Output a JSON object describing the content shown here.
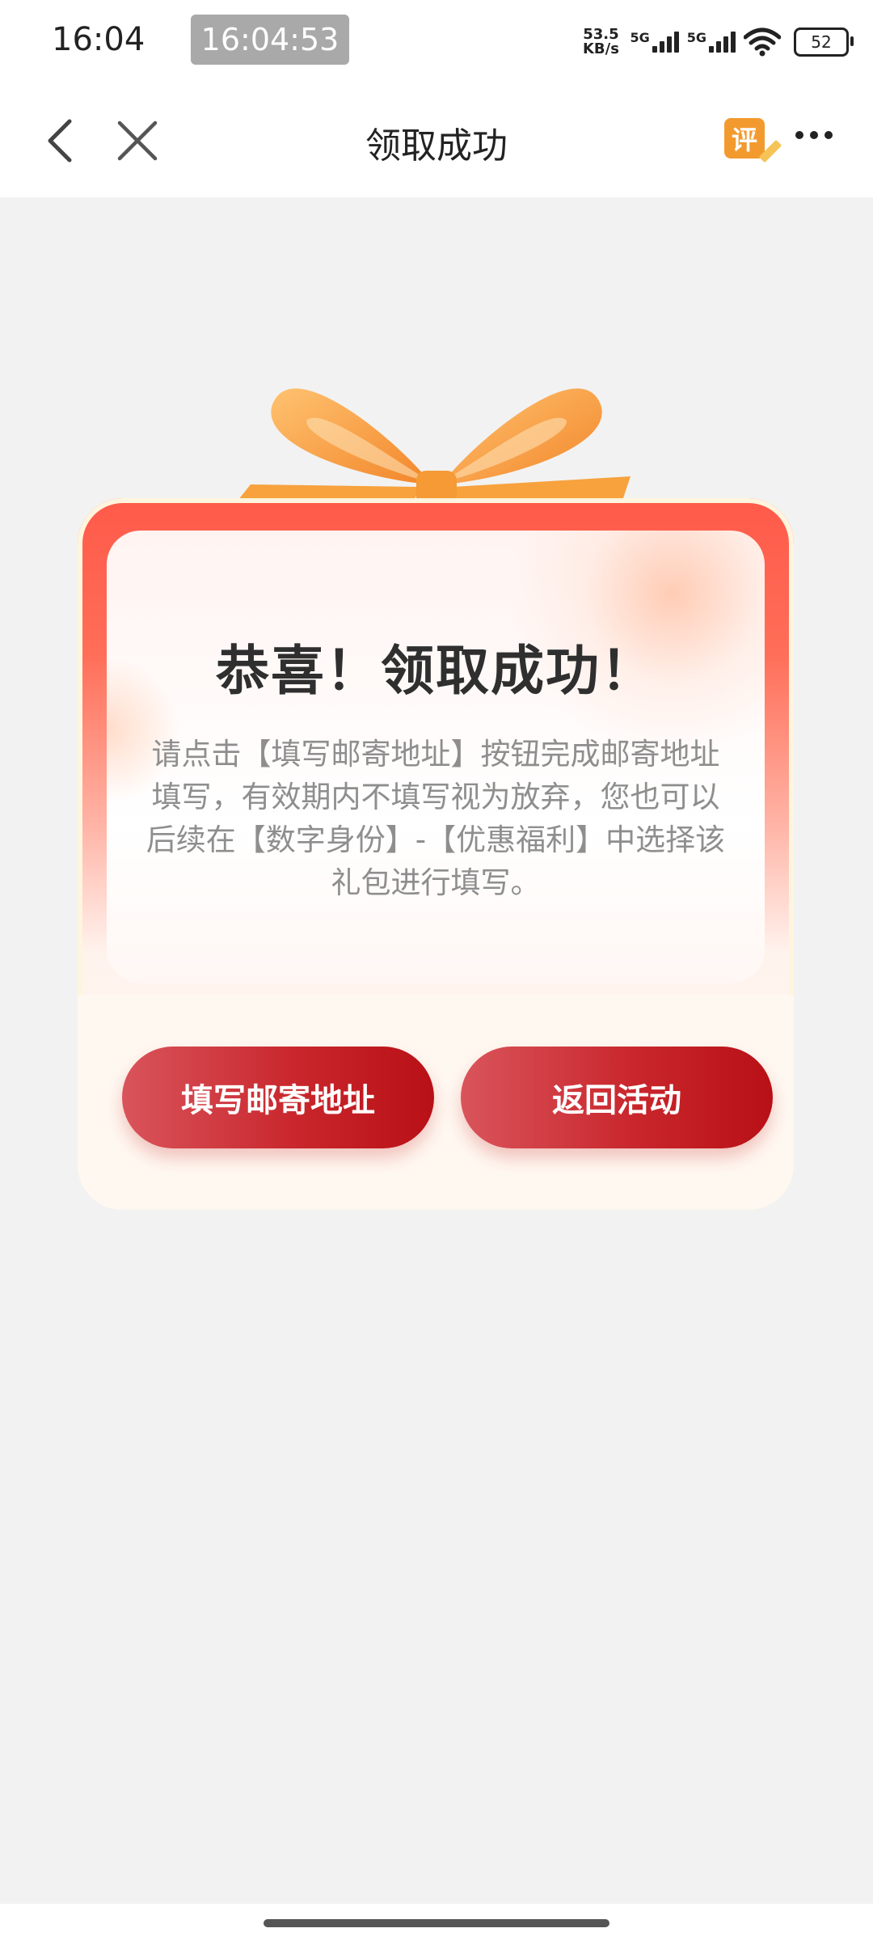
{
  "status_bar": {
    "time": "16:04",
    "clock_chip": "16:04:53",
    "net_speed_value": "53.5",
    "net_speed_unit": "KB/s",
    "net_label_1": "5G",
    "net_label_2": "5G",
    "battery": "52"
  },
  "nav": {
    "title": "领取成功",
    "review_label": "评"
  },
  "card": {
    "title": "恭喜！领取成功！",
    "description": "请点击【填写邮寄地址】按钮完成邮寄地址填写，有效期内不填写视为放弃，您也可以后续在【数字身份】-【优惠福利】中选择该礼包进行填写。"
  },
  "buttons": {
    "fill_address": "填写邮寄地址",
    "return_activity": "返回活动"
  },
  "colors": {
    "accent_red": "#c9272d",
    "ribbon_orange": "#f7a23d",
    "card_top": "#ff5a4a"
  }
}
